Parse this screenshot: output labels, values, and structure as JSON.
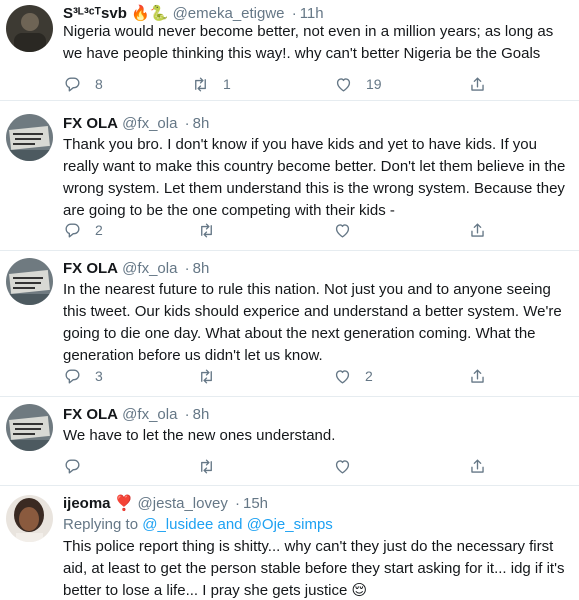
{
  "tweets": [
    {
      "name": "S³ᴸ³ᶜᵀsvb 🔥🐍",
      "handle": "@emeka_etigwe",
      "time": "11h",
      "body": "Nigeria would never become better, not even in a million years; as long as we have people thinking this way!. why can't better Nigeria be the Goals",
      "replies": "8",
      "retweets": "1",
      "likes": "19"
    },
    {
      "name": "FX OLA",
      "handle": "@fx_ola",
      "time": "8h",
      "body": "Thank you bro. I don't know if you have kids and yet to have kids. If you really want to make this country become better. Don't let them believe in the wrong system. Let them understand this is the wrong system. Because they are going to be the one competing with their kids -",
      "replies": "2",
      "retweets": "",
      "likes": ""
    },
    {
      "name": "FX OLA",
      "handle": "@fx_ola",
      "time": "8h",
      "body": "In the nearest future to rule this nation.  Not just you and to anyone seeing this tweet. Our kids should experice and understand a better system. We're going to die one day. What about the next generation coming. What the generation before us didn't let us know.",
      "replies": "3",
      "retweets": "",
      "likes": "2"
    },
    {
      "name": "FX OLA",
      "handle": "@fx_ola",
      "time": "8h",
      "body": "We have to let the new ones understand.",
      "replies": "",
      "retweets": "",
      "likes": ""
    },
    {
      "name": "ijeoma ❣️",
      "handle": "@jesta_lovey",
      "time": "15h",
      "replying_prefix": "Replying to ",
      "replying_user1": "@_lusidee",
      "replying_and": " and ",
      "replying_user2": "@Oje_simps",
      "body": "This police report thing is shitty... why can't they just do the necessary first aid, at least to get the person stable before they start asking for it... idg if it's better to lose a life... I pray she gets justice 😌",
      "replies": "",
      "retweets": "",
      "likes": ""
    }
  ],
  "separator": "·",
  "icons": {
    "reply": "reply-icon",
    "retweet": "retweet-icon",
    "like": "heart-icon",
    "share": "share-icon"
  },
  "colors": {
    "text": "#14171a",
    "muted": "#657786",
    "link": "#1da1f2",
    "border": "#e6ecf0"
  }
}
